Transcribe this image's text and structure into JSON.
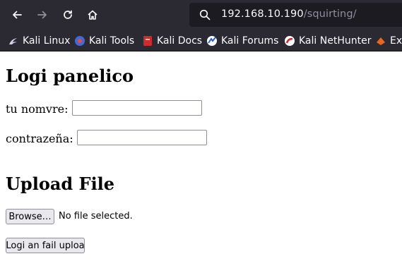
{
  "browser": {
    "url_host": "192.168.10.190",
    "url_path": "/squirting/",
    "bookmarks": [
      {
        "label": "Kali Linux",
        "icon": "kali-dragon-icon"
      },
      {
        "label": "Kali Tools",
        "icon": "kali-tools-icon"
      },
      {
        "label": "Kali Docs",
        "icon": "kali-docs-icon"
      },
      {
        "label": "Kali Forums",
        "icon": "kali-forums-icon"
      },
      {
        "label": "Kali NetHunter",
        "icon": "kali-nethunter-icon"
      },
      {
        "label": "Exp",
        "icon": "exploit-db-icon"
      }
    ]
  },
  "page": {
    "title": "Logi panelico",
    "username_label": "tu nomvre:",
    "username_value": "",
    "password_label": "contrazeña:",
    "password_value": "",
    "upload_heading": "Upload File",
    "browse_label": "Browse…",
    "file_status": "No file selected.",
    "submit_label": "Logi an fail uploa"
  }
}
